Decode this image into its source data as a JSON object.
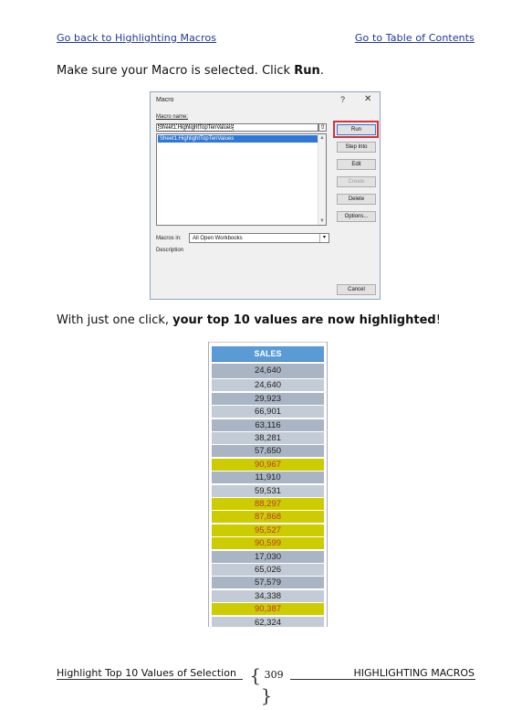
{
  "nav": {
    "back_link": "Go back to Highlighting Macros",
    "toc_link": "Go to Table of Contents"
  },
  "para1": {
    "pre": "Make sure your Macro is selected. Click ",
    "bold": "Run",
    "post": "."
  },
  "dialog": {
    "title": "Macro",
    "help": "?",
    "close": "✕",
    "macro_name_label": "Macro name:",
    "macro_name_value": "Sheet1.HighlightTopTenValues",
    "list_items": [
      "Sheet1.HighlightTopTenValues"
    ],
    "macros_in_label": "Macros in:",
    "macros_in_value": "All Open Workbooks",
    "description_label": "Description",
    "buttons": {
      "run": "Run",
      "step_into": "Step Into",
      "edit": "Edit",
      "create": "Create",
      "delete": "Delete",
      "options": "Options...",
      "cancel": "Cancel"
    }
  },
  "para2": {
    "pre": "With just one click, ",
    "bold": "your top 10 values are now highlighted",
    "post": "!"
  },
  "sales": {
    "header": "SALES",
    "highlight_color": "#cccc00",
    "highlight_text_color": "#c0392b",
    "rows": [
      {
        "value": "24,640",
        "highlight": false
      },
      {
        "value": "24,640",
        "highlight": false
      },
      {
        "value": "29,923",
        "highlight": false
      },
      {
        "value": "66,901",
        "highlight": false
      },
      {
        "value": "63,116",
        "highlight": false
      },
      {
        "value": "38,281",
        "highlight": false
      },
      {
        "value": "57,650",
        "highlight": false
      },
      {
        "value": "90,967",
        "highlight": true
      },
      {
        "value": "11,910",
        "highlight": false
      },
      {
        "value": "59,531",
        "highlight": false
      },
      {
        "value": "88,297",
        "highlight": true
      },
      {
        "value": "87,868",
        "highlight": true
      },
      {
        "value": "95,527",
        "highlight": true
      },
      {
        "value": "90,599",
        "highlight": true
      },
      {
        "value": "17,030",
        "highlight": false
      },
      {
        "value": "65,026",
        "highlight": false
      },
      {
        "value": "57,579",
        "highlight": false
      },
      {
        "value": "34,338",
        "highlight": false
      },
      {
        "value": "90,387",
        "highlight": true
      },
      {
        "value": "62,324",
        "highlight": false
      }
    ]
  },
  "footer": {
    "left": "Highlight Top 10 Values of Selection",
    "page": "309",
    "right": "HIGHLIGHTING MACROS"
  }
}
